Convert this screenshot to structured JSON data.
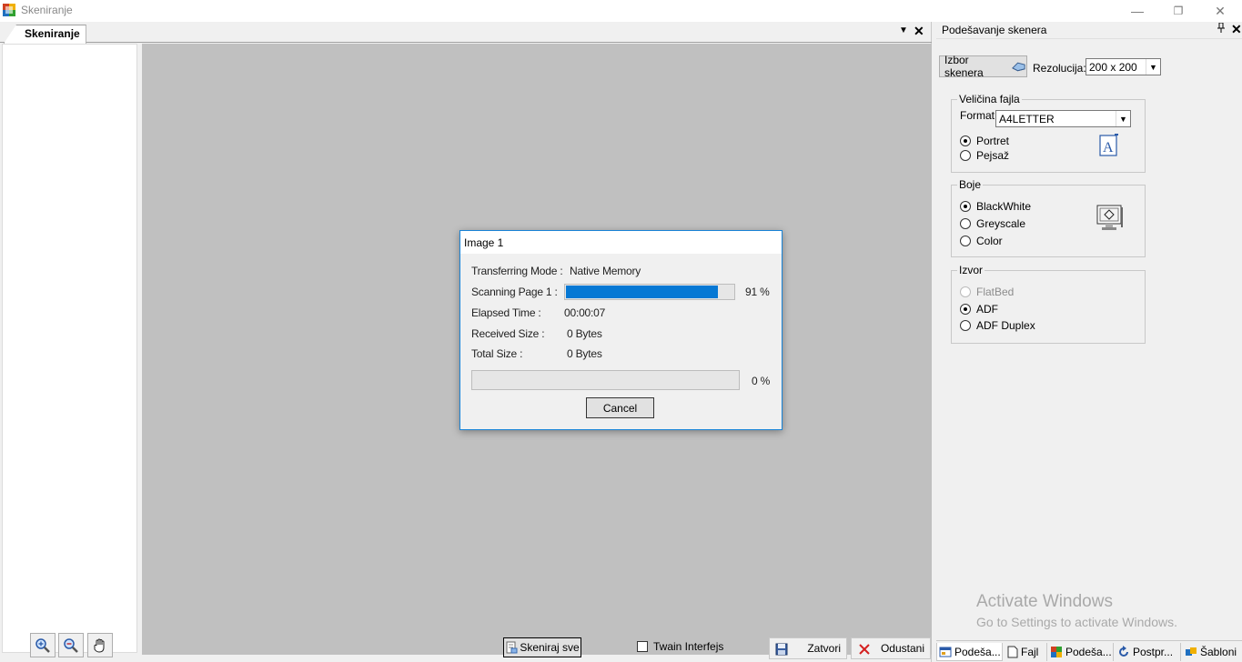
{
  "window": {
    "title": "Skeniranje",
    "minimize": "—",
    "restore": "❐",
    "close": "✕"
  },
  "doc_tabs": {
    "active_tab": "Skeniranje",
    "dropdown": "▼",
    "close": "✕"
  },
  "toolbar": {
    "scan_all_label": "Skeniraj sve",
    "twain_label": "Twain Interfejs",
    "twain_checked": false,
    "close_label": "Zatvori",
    "cancel_label": "Odustani"
  },
  "dialog": {
    "title": "Image 1",
    "transfer_mode_label": "Transferring Mode :",
    "transfer_mode_value": "Native Memory",
    "scanning_label": "Scanning Page 1 :",
    "scanning_progress": 91,
    "scanning_percent_text": "91 %",
    "elapsed_label": "Elapsed Time :",
    "elapsed_value": "00:00:07",
    "received_label": "Received Size :",
    "received_value": "0 Bytes",
    "total_label": "Total Size :",
    "total_value": "0 Bytes",
    "overall_progress": 0,
    "overall_percent_text": "0 %",
    "cancel_label": "Cancel"
  },
  "right_panel": {
    "title": "Podešavanje skenera",
    "pin": "📌",
    "close": "✕",
    "izbor_label": "Izbor skenera",
    "rezolucija_label": "Rezolucija:",
    "rezolucija_value": "200 x 200",
    "velicina": {
      "title": "Veličina fajla",
      "format_label": "Format",
      "format_value": "A4LETTER",
      "orientation": [
        {
          "label": "Portret",
          "checked": true
        },
        {
          "label": "Pejsaž",
          "checked": false
        }
      ]
    },
    "boje": {
      "title": "Boje",
      "options": [
        {
          "label": "BlackWhite",
          "checked": true
        },
        {
          "label": "Greyscale",
          "checked": false
        },
        {
          "label": "Color",
          "checked": false
        }
      ]
    },
    "izvor": {
      "title": "Izvor",
      "options": [
        {
          "label": "FlatBed",
          "checked": false,
          "disabled": true
        },
        {
          "label": "ADF",
          "checked": true,
          "disabled": false
        },
        {
          "label": "ADF Duplex",
          "checked": false,
          "disabled": false
        }
      ]
    },
    "watermark_line1": "Activate Windows",
    "watermark_line2": "Go to Settings to activate Windows.",
    "bottom_tabs": [
      "Podeša...",
      "Fajl",
      "Podeša...",
      "Postpr...",
      "Šabloni"
    ]
  }
}
